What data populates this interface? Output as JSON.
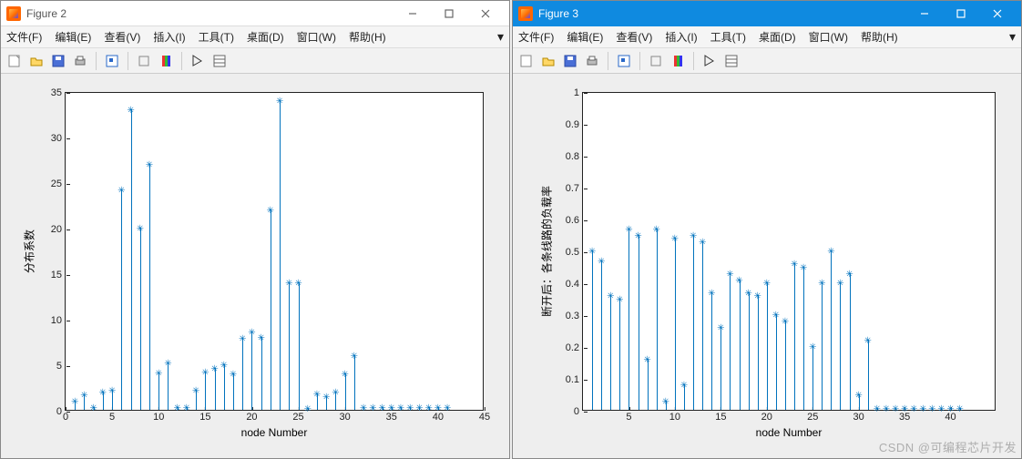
{
  "windows": [
    {
      "id": "fig2",
      "title": "Figure 2",
      "active": false
    },
    {
      "id": "fig3",
      "title": "Figure 3",
      "active": true
    }
  ],
  "menu": {
    "file": "文件(F)",
    "edit": "编辑(E)",
    "view": "查看(V)",
    "insert": "插入(I)",
    "tools": "工具(T)",
    "desktop": "桌面(D)",
    "window": "窗口(W)",
    "help": "帮助(H)"
  },
  "toolbar": {
    "new": "new-figure",
    "open": "open",
    "save": "save",
    "print": "print",
    "datacursor": "data-cursor",
    "link": "link-plot",
    "colorbar": "colorbar",
    "legend": "legend",
    "arrow": "edit-plot",
    "prop": "property-inspector"
  },
  "watermark": "CSDN @可编程芯片开发",
  "chart_data": [
    {
      "type": "stem",
      "xlabel": "node Number",
      "ylabel": "分布系数",
      "xlim": [
        0,
        45
      ],
      "ylim": [
        0,
        35
      ],
      "xticks": [
        0,
        5,
        10,
        15,
        20,
        25,
        30,
        35,
        40,
        45
      ],
      "yticks": [
        0,
        5,
        10,
        15,
        20,
        25,
        30,
        35
      ],
      "x": [
        1,
        2,
        3,
        4,
        5,
        6,
        7,
        8,
        9,
        10,
        11,
        12,
        13,
        14,
        15,
        16,
        17,
        18,
        19,
        20,
        21,
        22,
        23,
        24,
        25,
        26,
        27,
        28,
        29,
        30,
        31,
        32,
        33,
        34,
        35,
        36,
        37,
        38,
        39,
        40,
        41
      ],
      "values": [
        1.0,
        1.7,
        0.3,
        2.0,
        2.2,
        24.2,
        33.0,
        20.0,
        27.0,
        4.1,
        5.2,
        0.3,
        0.3,
        2.2,
        4.2,
        4.6,
        5.0,
        4.0,
        7.9,
        8.6,
        8.0,
        22.0,
        34.0,
        14.0,
        14.0,
        0.2,
        1.8,
        1.5,
        2.0,
        4.0,
        6.0,
        0.3,
        0.3,
        0.3,
        0.3,
        0.3,
        0.3,
        0.3,
        0.3,
        0.3,
        0.3
      ]
    },
    {
      "type": "stem",
      "xlabel": "node Number",
      "ylabel": "断开后：各条线路的负载率",
      "xlim": [
        0,
        45
      ],
      "ylim": [
        0,
        1
      ],
      "xticks": [
        5,
        10,
        15,
        20,
        25,
        30,
        35,
        40
      ],
      "yticks": [
        0,
        0.1,
        0.2,
        0.3,
        0.4,
        0.5,
        0.6,
        0.7,
        0.8,
        0.9,
        1
      ],
      "x": [
        1,
        2,
        3,
        4,
        5,
        6,
        7,
        8,
        9,
        10,
        11,
        12,
        13,
        14,
        15,
        16,
        17,
        18,
        19,
        20,
        21,
        22,
        23,
        24,
        25,
        26,
        27,
        28,
        29,
        30,
        31,
        32,
        33,
        34,
        35,
        36,
        37,
        38,
        39,
        40,
        41
      ],
      "values": [
        0.5,
        0.47,
        0.36,
        0.35,
        0.57,
        0.55,
        0.16,
        0.57,
        0.03,
        0.54,
        0.08,
        0.55,
        0.53,
        0.37,
        0.26,
        0.43,
        0.41,
        0.37,
        0.36,
        0.4,
        0.3,
        0.28,
        0.46,
        0.45,
        0.2,
        0.4,
        0.5,
        0.4,
        0.43,
        0.05,
        0.22,
        0.005,
        0.005,
        0.005,
        0.005,
        0.005,
        0.005,
        0.005,
        0.005,
        0.005,
        0.005
      ]
    }
  ]
}
